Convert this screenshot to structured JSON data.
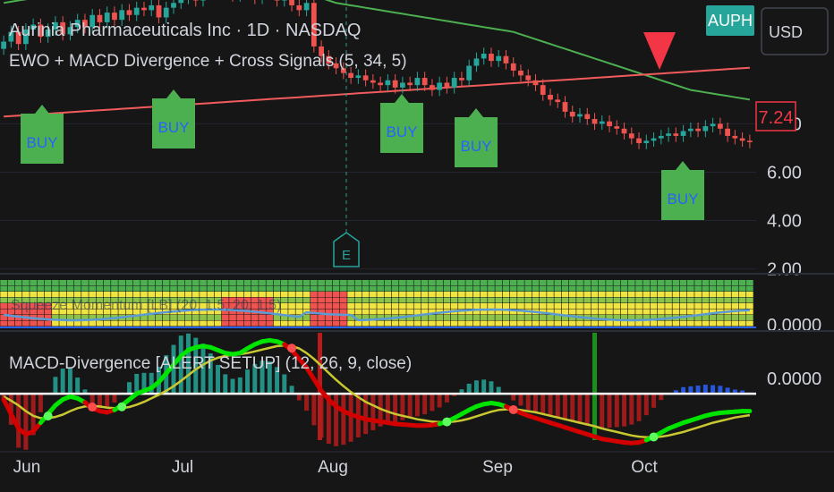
{
  "header": {
    "title": "Aurinia Pharmaceuticals Inc · 1D · NASDAQ",
    "indicator": "EWO + MACD Divergence + Cross Signals (5, 34, 5)",
    "ticker": "AUPH",
    "currency": "USD"
  },
  "pane_labels": {
    "middle_obscured": "Squeeze Momentum [LB] (20, 1.5, 20, 1.5)",
    "macd": "MACD-Divergence [ALERT SETUP] (12, 26, 9, close)"
  },
  "price_axis": {
    "ticks": [
      {
        "value": 8,
        "label": "8.00"
      },
      {
        "value": 6,
        "label": "6.00"
      },
      {
        "value": 4,
        "label": "4.00"
      },
      {
        "value": 2,
        "label": "2.00"
      }
    ],
    "last_price": {
      "value": 7.24,
      "label": "7.24"
    }
  },
  "mid_axis": {
    "label": "0.0000"
  },
  "macd_axis": {
    "label": "0.0000"
  },
  "time_axis": {
    "labels": [
      "Jun",
      "Jul",
      "Aug",
      "Sep",
      "Oct"
    ]
  },
  "earnings_marker": {
    "letter": "E"
  },
  "colors": {
    "background": "#161616",
    "buy_label": "#4caf50",
    "buy_text": "#2962ff",
    "sell_triangle": "#f23645",
    "ma_red": "#f15b5b",
    "ma_green": "#4caf50",
    "candle_up": "#26a69a",
    "candle_down": "#ef5350",
    "macd_green": "#00e500",
    "macd_red": "#d40000",
    "signal_yellow": "#c8c830"
  },
  "chart_data": [
    {
      "type": "line",
      "title": "Aurinia Pharmaceuticals Inc · 1D · NASDAQ",
      "x": [
        "Jun",
        "",
        "",
        "",
        "",
        "",
        "",
        "",
        "",
        "",
        "",
        "",
        "",
        "",
        "",
        "",
        "",
        "",
        "",
        "",
        "Jul",
        "",
        "",
        "",
        "",
        "",
        "",
        "",
        "",
        "",
        "",
        "",
        "",
        "",
        "",
        "",
        "",
        "",
        "",
        "",
        "",
        "",
        "Aug",
        "",
        "",
        "",
        "",
        "",
        "",
        "",
        "",
        "",
        "",
        "",
        "",
        "",
        "",
        "",
        "",
        "",
        "",
        "",
        "",
        "",
        "Sep",
        "",
        "",
        "",
        "",
        "",
        "",
        "",
        "",
        "",
        "",
        "",
        "",
        "",
        "",
        "",
        "",
        "",
        "",
        "",
        "",
        "Oct",
        "",
        "",
        "",
        "",
        "",
        "",
        "",
        "",
        "",
        "",
        "",
        "",
        "",
        ""
      ],
      "series": [
        {
          "name": "close",
          "values": [
            11.4,
            11.8,
            11.3,
            11.9,
            12.1,
            11.6,
            11.9,
            12.2,
            11.7,
            12.0,
            12.3,
            12.0,
            12.5,
            12.2,
            12.6,
            12.3,
            12.7,
            12.5,
            12.8,
            12.7,
            12.9,
            12.4,
            12.8,
            13.0,
            13.2,
            13.5,
            13.1,
            13.6,
            13.4,
            13.8,
            13.6,
            13.3,
            13.9,
            13.5,
            13.2,
            13.7,
            13.4,
            13.1,
            13.6,
            12.9,
            12.7,
            13.0,
            11.2,
            10.8,
            10.5,
            10.3,
            10.1,
            9.9,
            10.0,
            9.8,
            9.7,
            9.6,
            9.8,
            9.5,
            9.7,
            9.6,
            9.9,
            9.6,
            9.4,
            9.7,
            9.5,
            9.9,
            9.8,
            10.4,
            10.7,
            10.9,
            10.6,
            10.8,
            10.5,
            10.2,
            10.0,
            9.8,
            9.6,
            9.2,
            9.0,
            8.9,
            8.5,
            8.3,
            8.4,
            8.2,
            8.0,
            8.1,
            7.9,
            7.8,
            7.6,
            7.4,
            7.2,
            7.3,
            7.4,
            7.5,
            7.6,
            7.5,
            7.7,
            7.8,
            7.7,
            7.9,
            8.0,
            7.8,
            7.5,
            7.4,
            7.3,
            7.24
          ]
        },
        {
          "name": "MA red",
          "values": [
            8.3,
            8.32,
            8.34,
            8.36,
            8.38,
            8.4,
            8.42,
            8.44,
            8.46,
            8.48,
            8.5,
            8.52,
            8.54,
            8.56,
            8.58,
            8.6,
            8.62,
            8.64,
            8.66,
            8.68,
            8.7,
            8.72,
            8.74,
            8.76,
            8.78,
            8.8,
            8.82,
            8.84,
            8.86,
            8.88,
            8.9,
            8.92,
            8.94,
            8.96,
            8.98,
            9.0,
            9.02,
            9.04,
            9.06,
            9.08,
            9.1,
            9.12,
            9.14,
            9.16,
            9.18,
            9.2,
            9.22,
            9.24,
            9.26,
            9.28,
            9.3,
            9.32,
            9.34,
            9.36,
            9.38,
            9.4,
            9.42,
            9.44,
            9.46,
            9.48,
            9.5,
            9.52,
            9.54,
            9.56,
            9.58,
            9.6,
            9.62,
            9.64,
            9.66,
            9.68,
            9.7,
            9.72,
            9.74,
            9.76,
            9.78,
            9.8,
            9.82,
            9.84,
            9.86,
            9.88,
            9.9,
            9.92,
            9.94,
            9.96,
            9.98,
            10.0,
            10.02,
            10.04,
            10.06,
            10.08,
            10.1,
            10.12,
            10.14,
            10.16,
            10.18,
            10.2,
            10.22,
            10.24,
            10.26,
            10.28,
            10.3,
            10.32
          ]
        },
        {
          "name": "MA green",
          "values": [
            13.0,
            13.05,
            13.1,
            13.15,
            13.2,
            13.25,
            13.3,
            13.35,
            13.4,
            13.45,
            13.5,
            13.55,
            13.6,
            13.65,
            13.7,
            13.75,
            13.8,
            13.85,
            13.9,
            13.95,
            14.0,
            14.02,
            14.04,
            14.06,
            14.08,
            14.1,
            14.1,
            14.1,
            14.1,
            14.1,
            14.1,
            14.08,
            14.06,
            14.04,
            14.02,
            14.0,
            13.9,
            13.8,
            13.7,
            13.6,
            13.5,
            13.4,
            13.3,
            13.2,
            13.1,
            13.0,
            12.95,
            12.9,
            12.85,
            12.8,
            12.75,
            12.7,
            12.65,
            12.6,
            12.55,
            12.5,
            12.45,
            12.4,
            12.35,
            12.3,
            12.25,
            12.2,
            12.15,
            12.1,
            12.05,
            12.0,
            11.95,
            11.9,
            11.85,
            11.8,
            11.7,
            11.6,
            11.5,
            11.4,
            11.3,
            11.2,
            11.1,
            11.0,
            10.9,
            10.8,
            10.7,
            10.6,
            10.5,
            10.4,
            10.3,
            10.2,
            10.1,
            10.0,
            9.9,
            9.8,
            9.7,
            9.6,
            9.5,
            9.4,
            9.35,
            9.3,
            9.25,
            9.2,
            9.15,
            9.1,
            9.05,
            9.0
          ]
        }
      ],
      "annotations": [
        "BUY",
        "BUY",
        "BUY",
        "BUY",
        "BUY",
        "SELL"
      ],
      "ylim": [
        1.8,
        14.6
      ]
    },
    {
      "type": "line",
      "title": "MACD-Divergence [ALERT SETUP] (12, 26, 9, close)",
      "x": [
        "Jun",
        "",
        "",
        "",
        "",
        "",
        "",
        "",
        "",
        "",
        "",
        "",
        "",
        "",
        "",
        "",
        "",
        "",
        "",
        "",
        "Jul",
        "",
        "",
        "",
        "",
        "",
        "",
        "",
        "",
        "",
        "",
        "",
        "",
        "",
        "",
        "",
        "",
        "",
        "",
        "",
        "",
        "",
        "Aug",
        "",
        "",
        "",
        "",
        "",
        "",
        "",
        "",
        "",
        "",
        "",
        "",
        "",
        "",
        "",
        "",
        "",
        "",
        "",
        "",
        "",
        "Sep",
        "",
        "",
        "",
        "",
        "",
        "",
        "",
        "",
        "",
        "",
        "",
        "",
        "",
        "",
        "",
        "",
        "",
        "",
        "",
        "",
        "Oct",
        "",
        "",
        "",
        "",
        "",
        "",
        "",
        "",
        "",
        "",
        "",
        "",
        "",
        ""
      ],
      "series": [
        {
          "name": "macd",
          "values": [
            -0.1,
            -0.35,
            -0.6,
            -0.7,
            -0.65,
            -0.5,
            -0.35,
            -0.2,
            -0.1,
            -0.05,
            -0.08,
            -0.15,
            -0.25,
            -0.3,
            -0.32,
            -0.28,
            -0.2,
            -0.1,
            0.0,
            0.05,
            0.1,
            0.2,
            0.35,
            0.5,
            0.65,
            0.75,
            0.8,
            0.82,
            0.8,
            0.75,
            0.7,
            0.68,
            0.7,
            0.78,
            0.85,
            0.9,
            0.92,
            0.9,
            0.85,
            0.75,
            0.6,
            0.45,
            0.25,
            0.05,
            -0.1,
            -0.22,
            -0.3,
            -0.36,
            -0.4,
            -0.44,
            -0.46,
            -0.48,
            -0.5,
            -0.52,
            -0.53,
            -0.54,
            -0.55,
            -0.55,
            -0.54,
            -0.52,
            -0.48,
            -0.42,
            -0.35,
            -0.28,
            -0.22,
            -0.18,
            -0.16,
            -0.18,
            -0.22,
            -0.28,
            -0.33,
            -0.38,
            -0.42,
            -0.46,
            -0.5,
            -0.54,
            -0.58,
            -0.62,
            -0.66,
            -0.7,
            -0.74,
            -0.78,
            -0.8,
            -0.82,
            -0.84,
            -0.85,
            -0.84,
            -0.8,
            -0.74,
            -0.67,
            -0.6,
            -0.55,
            -0.5,
            -0.46,
            -0.42,
            -0.38,
            -0.35,
            -0.33,
            -0.32,
            -0.31,
            -0.3,
            -0.3
          ]
        },
        {
          "name": "signal",
          "values": [
            -0.05,
            -0.12,
            -0.2,
            -0.3,
            -0.38,
            -0.42,
            -0.42,
            -0.4,
            -0.36,
            -0.3,
            -0.25,
            -0.22,
            -0.21,
            -0.22,
            -0.24,
            -0.25,
            -0.25,
            -0.23,
            -0.19,
            -0.14,
            -0.08,
            -0.02,
            0.05,
            0.13,
            0.22,
            0.32,
            0.42,
            0.5,
            0.57,
            0.62,
            0.65,
            0.67,
            0.68,
            0.7,
            0.73,
            0.76,
            0.79,
            0.82,
            0.83,
            0.82,
            0.78,
            0.7,
            0.6,
            0.48,
            0.36,
            0.24,
            0.13,
            0.03,
            -0.06,
            -0.14,
            -0.2,
            -0.26,
            -0.31,
            -0.35,
            -0.38,
            -0.41,
            -0.44,
            -0.46,
            -0.48,
            -0.49,
            -0.49,
            -0.48,
            -0.46,
            -0.43,
            -0.39,
            -0.35,
            -0.31,
            -0.28,
            -0.27,
            -0.27,
            -0.28,
            -0.3,
            -0.32,
            -0.35,
            -0.38,
            -0.41,
            -0.44,
            -0.47,
            -0.5,
            -0.53,
            -0.56,
            -0.6,
            -0.63,
            -0.66,
            -0.69,
            -0.72,
            -0.74,
            -0.75,
            -0.75,
            -0.74,
            -0.72,
            -0.69,
            -0.66,
            -0.62,
            -0.58,
            -0.54,
            -0.5,
            -0.47,
            -0.44,
            -0.41,
            -0.39,
            -0.37
          ]
        }
      ],
      "ylim": [
        -1.0,
        1.05
      ]
    }
  ]
}
